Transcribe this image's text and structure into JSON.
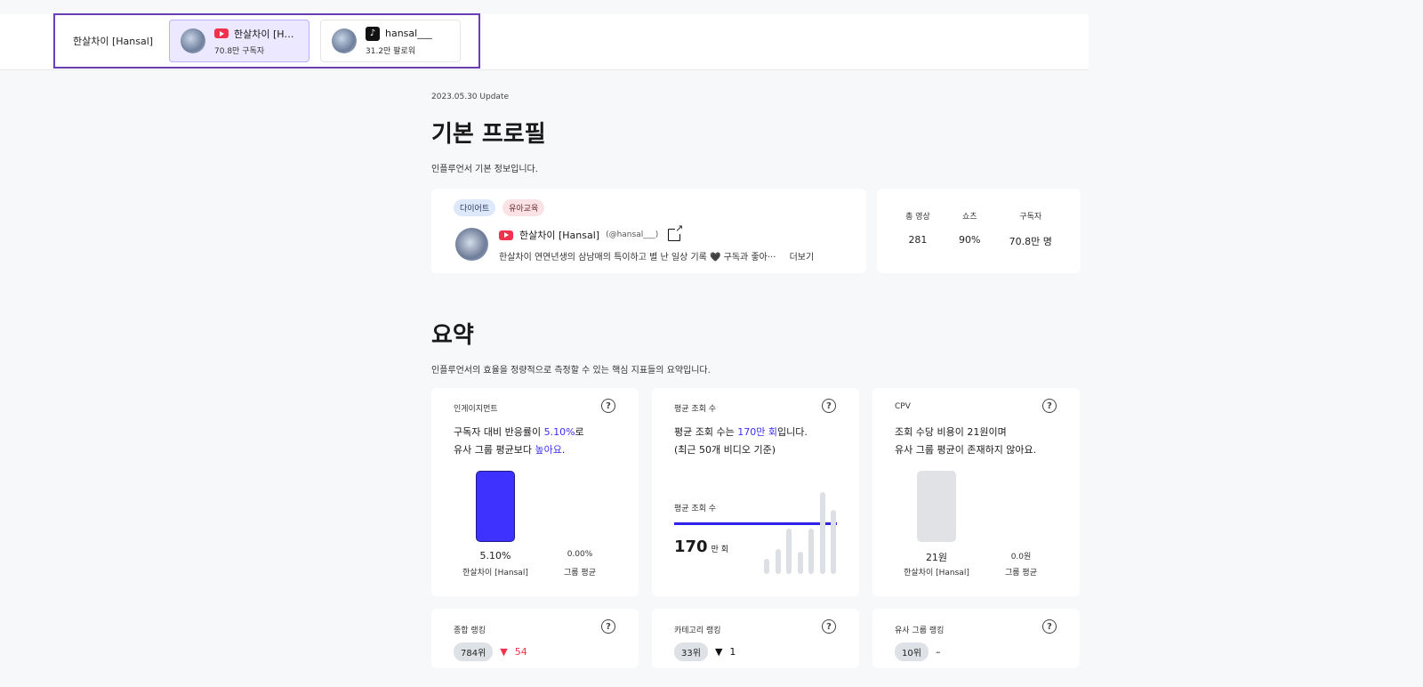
{
  "topbar": {
    "group_name": "한살차이 [Hansal]",
    "channels": [
      {
        "platform": "youtube",
        "name": "한살차이 [Han···",
        "followers": "70.8만 구독자",
        "active": true
      },
      {
        "platform": "tiktok",
        "name": "hansal___",
        "followers": "31.2만 팔로워",
        "active": false
      }
    ]
  },
  "profile_section": {
    "update": "2023.05.30 Update",
    "title": "기본 프로필",
    "description": "인플루언서 기본 정보입니다.",
    "tags": [
      "다이어트",
      "유아교육"
    ],
    "name": "한살차이 [Hansal]",
    "handle": "(@hansal___)",
    "bio": "한살차이 연연년생의 삼남매의 특이하고 별 난 일상 기록 🖤 구독과 좋아···",
    "more": "더보기",
    "stats": [
      {
        "label": "총 영상",
        "value": "281"
      },
      {
        "label": "쇼츠",
        "value": "90%"
      },
      {
        "label": "구독자",
        "value": "70.8만 명"
      }
    ]
  },
  "summary_section": {
    "title": "요약",
    "description": "인플루언서의 효율을 정량적으로 측정할 수 있는 핵심 지표들의 요약입니다.",
    "engagement": {
      "label": "인게이지먼트",
      "line1_pre": "구독자 대비 반응률이 ",
      "line1_hl": "5.10%",
      "line1_post": "로",
      "line2_pre": "유사 그룹 평균보다 ",
      "line2_hl": "높아요",
      "line2_post": ".",
      "self_value": "5.10%",
      "self_label": "한살차이 [Hansal]",
      "group_value": "0.00%",
      "group_label": "그룹 평균"
    },
    "avg_views": {
      "label": "평균 조회 수",
      "line1_pre": "평균 조회 수는 ",
      "line1_hl": "170만 회",
      "line1_post": "입니다.",
      "line2": "(최근 50개 비디오 기준)",
      "line_label": "평균 조회 수",
      "big_value": "170",
      "big_unit": "만 회",
      "bars": [
        0.18,
        0.3,
        0.55,
        0.27,
        0.55,
        1.0,
        0.78
      ]
    },
    "cpv": {
      "label": "CPV",
      "line1": "조회 수당 비용이 21원이며",
      "line2": "유사 그룹 평균이 존재하지 않아요.",
      "self_value": "21원",
      "self_label": "한살차이 [Hansal]",
      "group_value": "0.0원",
      "group_label": "그룹 평균"
    },
    "rankings": [
      {
        "label": "종합 랭킹",
        "rank": "784위",
        "arrow": "▼",
        "change": "54",
        "color": "red"
      },
      {
        "label": "카테고리 랭킹",
        "rank": "33위",
        "arrow": "▼",
        "change": "1",
        "color": "black"
      },
      {
        "label": "유사 그룹 랭킹",
        "rank": "10위",
        "arrow": "",
        "change": "–",
        "color": "black"
      }
    ]
  }
}
